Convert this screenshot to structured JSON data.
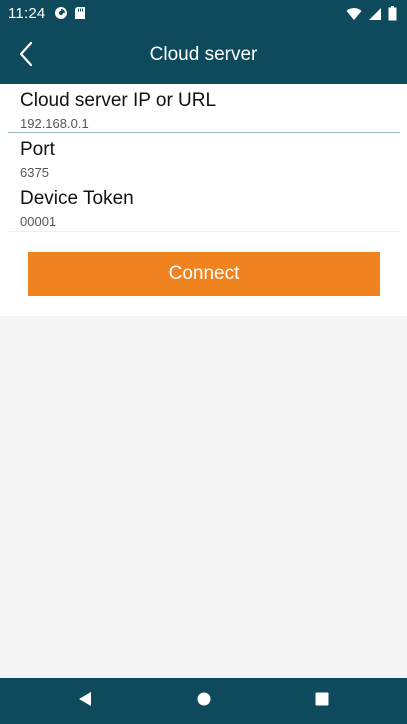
{
  "status_bar": {
    "time": "11:24",
    "icons": [
      "data-saver-icon",
      "sd-card-icon",
      "wifi-icon",
      "signal-icon",
      "battery-icon"
    ]
  },
  "app_bar": {
    "title": "Cloud server",
    "back_icon": "chevron-left-icon"
  },
  "form": {
    "fields": [
      {
        "label": "Cloud server IP or URL",
        "value": "192.168.0.1"
      },
      {
        "label": "Port",
        "value": "6375"
      },
      {
        "label": "Device Token",
        "value": "00001"
      }
    ],
    "connect_label": "Connect"
  },
  "nav_bar": {
    "buttons": [
      "back-triangle-icon",
      "home-circle-icon",
      "recents-square-icon"
    ]
  },
  "colors": {
    "primary": "#0e4a5c",
    "accent": "#f0821f",
    "background": "#f5f5f5"
  }
}
